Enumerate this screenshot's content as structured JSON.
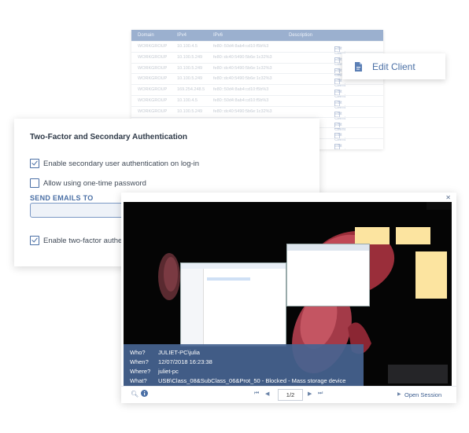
{
  "client_table": {
    "headers": [
      "Domain",
      "IPv4",
      "IPv6",
      "Description"
    ],
    "rows": [
      {
        "domain": "WORKGROUP",
        "ipv4": "10.100.4.5",
        "ipv6": "fe80::50d4:8ab4:cd10:f5b%3",
        "action": "Edit Client"
      },
      {
        "domain": "WORKGROUP",
        "ipv4": "10.100.5.249",
        "ipv6": "fe80::dc40:5490:5b6e:1c32%3",
        "action": "Edit Client"
      },
      {
        "domain": "WORKGROUP",
        "ipv4": "10.100.5.249",
        "ipv6": "fe80::dc40:5490:5b6e:1c32%3",
        "action": "Edit Client"
      },
      {
        "domain": "WORKGROUP",
        "ipv4": "10.100.5.249",
        "ipv6": "fe80::dc40:5490:5b6e:1c32%3",
        "action": "Edit Client"
      },
      {
        "domain": "WORKGROUP",
        "ipv4": "169.254.248.5",
        "ipv6": "fe80::50d4:8ab4:cd10:f5b%3",
        "action": "Edit Client"
      },
      {
        "domain": "WORKGROUP",
        "ipv4": "10.100.4.5",
        "ipv6": "fe80::50d4:8ab4:cd10:f5b%3",
        "action": "Edit Client"
      },
      {
        "domain": "WORKGROUP",
        "ipv4": "10.100.5.249",
        "ipv6": "fe80::dc40:5490:5b6e:1c32%3",
        "action": "Edit Client"
      },
      {
        "domain": "WORKGROUP",
        "ipv4": "10.100.5.249",
        "ipv6": "fe80::dc40:5490:5b6e:1c32%3",
        "action": "Edit Client"
      },
      {
        "domain": "WORKGROUP",
        "ipv4": "10.100.5.249",
        "ipv6": "fe80::dc40:5490:5b6e:1c32%3",
        "action": "Edit Client"
      },
      {
        "domain": "WORKGROUP",
        "ipv4": "10.100.5.249",
        "ipv6": "fe80::dc40:5490:5b6e:1c32%3",
        "action": "Edit Client"
      }
    ]
  },
  "edit_popup": {
    "label": "Edit Client",
    "icon": "edit-document-icon"
  },
  "auth_panel": {
    "title": "Two-Factor and Secondary Authentication",
    "secondary_auth": {
      "label": "Enable secondary user authentication on log-in",
      "checked": true
    },
    "otp": {
      "label": "Allow using one-time password",
      "checked": false
    },
    "send_emails_label": "SEND EMAILS TO",
    "send_emails_value": "",
    "two_factor": {
      "label": "Enable two-factor authentication",
      "checked": true
    }
  },
  "session": {
    "close_icon": "close-icon",
    "info": {
      "who_label": "Who?",
      "who_value": "JULIET-PC\\julia",
      "when_label": "When?",
      "when_value": "12/07/2018 16:23:38",
      "where_label": "Where?",
      "where_value": "juliet-pc",
      "what_label": "What?",
      "what_value": "USB\\Class_08&SubClass_06&Prot_50 - Blocked - Mass storage device"
    },
    "toolbar": {
      "page": "1/2",
      "open_session_label": "Open Session",
      "zoom_icon": "zoom-icon",
      "info_icon": "info-icon",
      "first_icon": "first-page-icon",
      "prev_icon": "prev-page-icon",
      "next_icon": "next-page-icon",
      "last_icon": "last-page-icon",
      "play_icon": "play-icon"
    }
  }
}
